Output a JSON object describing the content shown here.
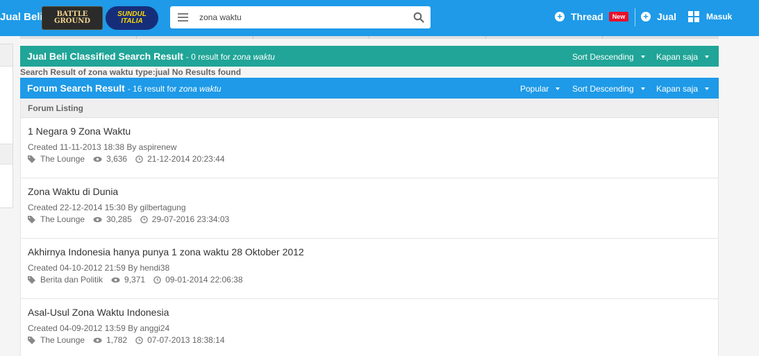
{
  "header": {
    "brand": "Jual Beli",
    "logos": [
      {
        "name": "battleground-logo",
        "line1": "BATTLE",
        "line2": "GROUND"
      },
      {
        "name": "sundul-italia-logo",
        "line1": "SUNDUL",
        "line2": "ITALIA"
      }
    ],
    "search_value": "zona waktu",
    "search_icon": "search-icon",
    "thread_label": "Thread",
    "new_badge": "New",
    "jual_label": "Jual",
    "masuk_label": "Masuk",
    "colors": {
      "bar": "#1e9ae8",
      "badge": "#e8102a"
    }
  },
  "jual_beli": {
    "title": "Jual Beli Classified Search Result",
    "count_text": "- 0 result for ",
    "query": "zona waktu",
    "sort": "Sort Descending",
    "time": "Kapan saja",
    "no_results": "Search Result of zona waktu type:jual No Results found",
    "color": "#20a598"
  },
  "forum": {
    "title": "Forum Search Result",
    "count_text": "- 16 result for ",
    "query": "zona waktu",
    "popular": "Popular",
    "sort": "Sort Descending",
    "time": "Kapan saja",
    "listing_label": "Forum Listing",
    "threads": [
      {
        "title": "1 Negara 9 Zona Waktu",
        "created": "Created 11-11-2013 18:38 By aspirenew",
        "category": "The Lounge",
        "views": "3,636",
        "last": "21-12-2014 20:23:44"
      },
      {
        "title": "Zona Waktu di Dunia",
        "created": "Created 22-12-2014 15:30 By gilbertagung",
        "category": "The Lounge",
        "views": "30,285",
        "last": "29-07-2016 23:34:03"
      },
      {
        "title": "Akhirnya Indonesia hanya punya 1 zona waktu 28 Oktober 2012",
        "created": "Created 04-10-2012 21:59 By hendi38",
        "category": "Berita dan Politik",
        "views": "9,371",
        "last": "09-01-2014 22:06:38"
      },
      {
        "title": "Asal-Usul Zona Waktu Indonesia",
        "created": "Created 04-09-2012 13:59 By anggi24",
        "category": "The Lounge",
        "views": "1,782",
        "last": "07-07-2013 18:38:14"
      }
    ]
  }
}
